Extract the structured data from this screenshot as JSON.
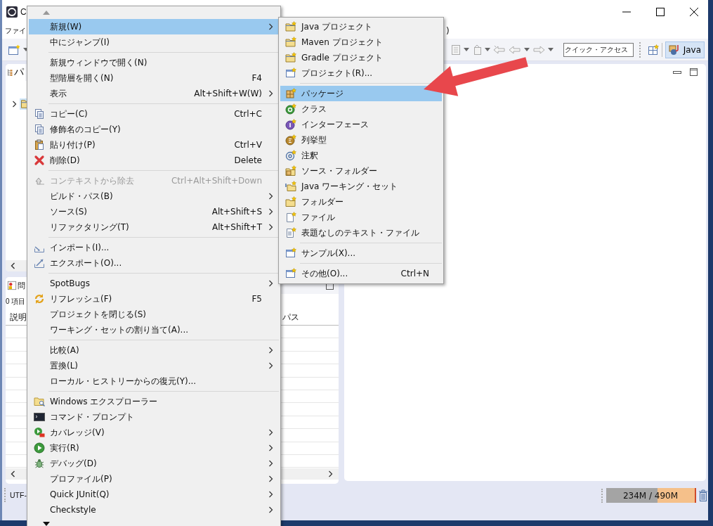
{
  "window": {
    "title": "C"
  },
  "menu_bar": [
    {
      "label": "ファイ"
    },
    {
      "label": ")"
    }
  ],
  "toolbar": {
    "quick_access": {
      "placeholder": "クイック・アクセス"
    },
    "perspectives": [
      {
        "label": "Java",
        "selected": true
      }
    ]
  },
  "package_explorer": {
    "tab": "パ",
    "tree": [
      {
        "expanded": false,
        "selected": true
      }
    ]
  },
  "problems": {
    "tab": "問",
    "summary": "0 項目",
    "columns": [
      "説明",
      "パス"
    ]
  },
  "status_bar": {
    "encoding": "UTF-",
    "memory": {
      "reading": "234M / 490M",
      "level": 0.58
    }
  },
  "context_menu": {
    "groups": [
      [
        {
          "label": "新規(W)",
          "submenu": true,
          "selected": true,
          "disabled": false
        },
        {
          "label": "中にジャンプ(I)",
          "submenu": false,
          "selected": false,
          "disabled": false
        }
      ],
      [
        {
          "label": "新規ウィンドウで開く(N)",
          "submenu": false,
          "selected": false,
          "disabled": false
        },
        {
          "label": "型階層を開く(N)",
          "shortcut": "F4",
          "submenu": false,
          "selected": false,
          "disabled": false
        },
        {
          "label": "表示",
          "shortcut": "Alt+Shift+W(W)",
          "submenu": true,
          "selected": false,
          "disabled": false
        }
      ],
      [
        {
          "label": "コピー(C)",
          "shortcut": "Ctrl+C",
          "submenu": false,
          "selected": false,
          "disabled": false
        },
        {
          "label": "修飾名のコピー(Y)",
          "submenu": false,
          "selected": false,
          "disabled": false
        },
        {
          "label": "貼り付け(P)",
          "shortcut": "Ctrl+V",
          "submenu": false,
          "selected": false,
          "disabled": false
        },
        {
          "label": "削除(D)",
          "shortcut": "Delete",
          "submenu": false,
          "selected": false,
          "disabled": false
        }
      ],
      [
        {
          "label": "コンテキストから除去",
          "shortcut": "Ctrl+Alt+Shift+Down",
          "submenu": false,
          "selected": false,
          "disabled": true
        },
        {
          "label": "ビルド・パス(B)",
          "submenu": true,
          "selected": false,
          "disabled": false
        },
        {
          "label": "ソース(S)",
          "shortcut": "Alt+Shift+S",
          "submenu": true,
          "selected": false,
          "disabled": false
        },
        {
          "label": "リファクタリング(T)",
          "shortcut": "Alt+Shift+T",
          "submenu": true,
          "selected": false,
          "disabled": false
        }
      ],
      [
        {
          "label": "インポート(I)...",
          "submenu": false,
          "selected": false,
          "disabled": false
        },
        {
          "label": "エクスポート(O)...",
          "submenu": false,
          "selected": false,
          "disabled": false
        }
      ],
      [
        {
          "label": "SpotBugs",
          "submenu": true,
          "selected": false,
          "disabled": false
        },
        {
          "label": "リフレッシュ(F)",
          "shortcut": "F5",
          "submenu": false,
          "selected": false,
          "disabled": false
        },
        {
          "label": "プロジェクトを閉じる(S)",
          "submenu": false,
          "selected": false,
          "disabled": false
        },
        {
          "label": "ワーキング・セットの割り当て(A)...",
          "submenu": false,
          "selected": false,
          "disabled": false
        }
      ],
      [
        {
          "label": "比較(A)",
          "submenu": true,
          "selected": false,
          "disabled": false
        },
        {
          "label": "置換(L)",
          "submenu": true,
          "selected": false,
          "disabled": false
        },
        {
          "label": "ローカル・ヒストリーからの復元(Y)...",
          "submenu": false,
          "selected": false,
          "disabled": false
        }
      ],
      [
        {
          "label": "Windows エクスプローラー",
          "submenu": false,
          "selected": false,
          "disabled": false
        },
        {
          "label": "コマンド・プロンプト",
          "submenu": false,
          "selected": false,
          "disabled": false
        },
        {
          "label": "カバレッジ(V)",
          "submenu": true,
          "selected": false,
          "disabled": false
        },
        {
          "label": "実行(R)",
          "submenu": true,
          "selected": false,
          "disabled": false
        },
        {
          "label": "デバッグ(D)",
          "submenu": true,
          "selected": false,
          "disabled": false
        },
        {
          "label": "プロファイル(P)",
          "submenu": true,
          "selected": false,
          "disabled": false
        },
        {
          "label": "Quick JUnit(Q)",
          "submenu": true,
          "selected": false,
          "disabled": false
        },
        {
          "label": "Checkstyle",
          "submenu": true,
          "selected": false,
          "disabled": false
        }
      ]
    ]
  },
  "submenu": {
    "groups": [
      [
        {
          "label": "Java プロジェクト",
          "selected": false
        },
        {
          "label": "Maven プロジェクト",
          "selected": false
        },
        {
          "label": "Gradle プロジェクト",
          "selected": false
        },
        {
          "label": "プロジェクト(R)...",
          "selected": false
        }
      ],
      [
        {
          "label": "パッケージ",
          "selected": true
        },
        {
          "label": "クラス",
          "selected": false
        },
        {
          "label": "インターフェース",
          "selected": false
        },
        {
          "label": "列挙型",
          "selected": false
        },
        {
          "label": "注釈",
          "selected": false
        },
        {
          "label": "ソース・フォルダー",
          "selected": false
        },
        {
          "label": "Java ワーキング・セット",
          "selected": false
        },
        {
          "label": "フォルダー",
          "selected": false
        },
        {
          "label": "ファイル",
          "selected": false
        },
        {
          "label": "表題なしのテキスト・ファイル",
          "selected": false
        }
      ],
      [
        {
          "label": "サンプル(X)...",
          "selected": false
        }
      ],
      [
        {
          "label": "その他(O)...",
          "shortcut": "Ctrl+N",
          "selected": false
        }
      ]
    ]
  }
}
